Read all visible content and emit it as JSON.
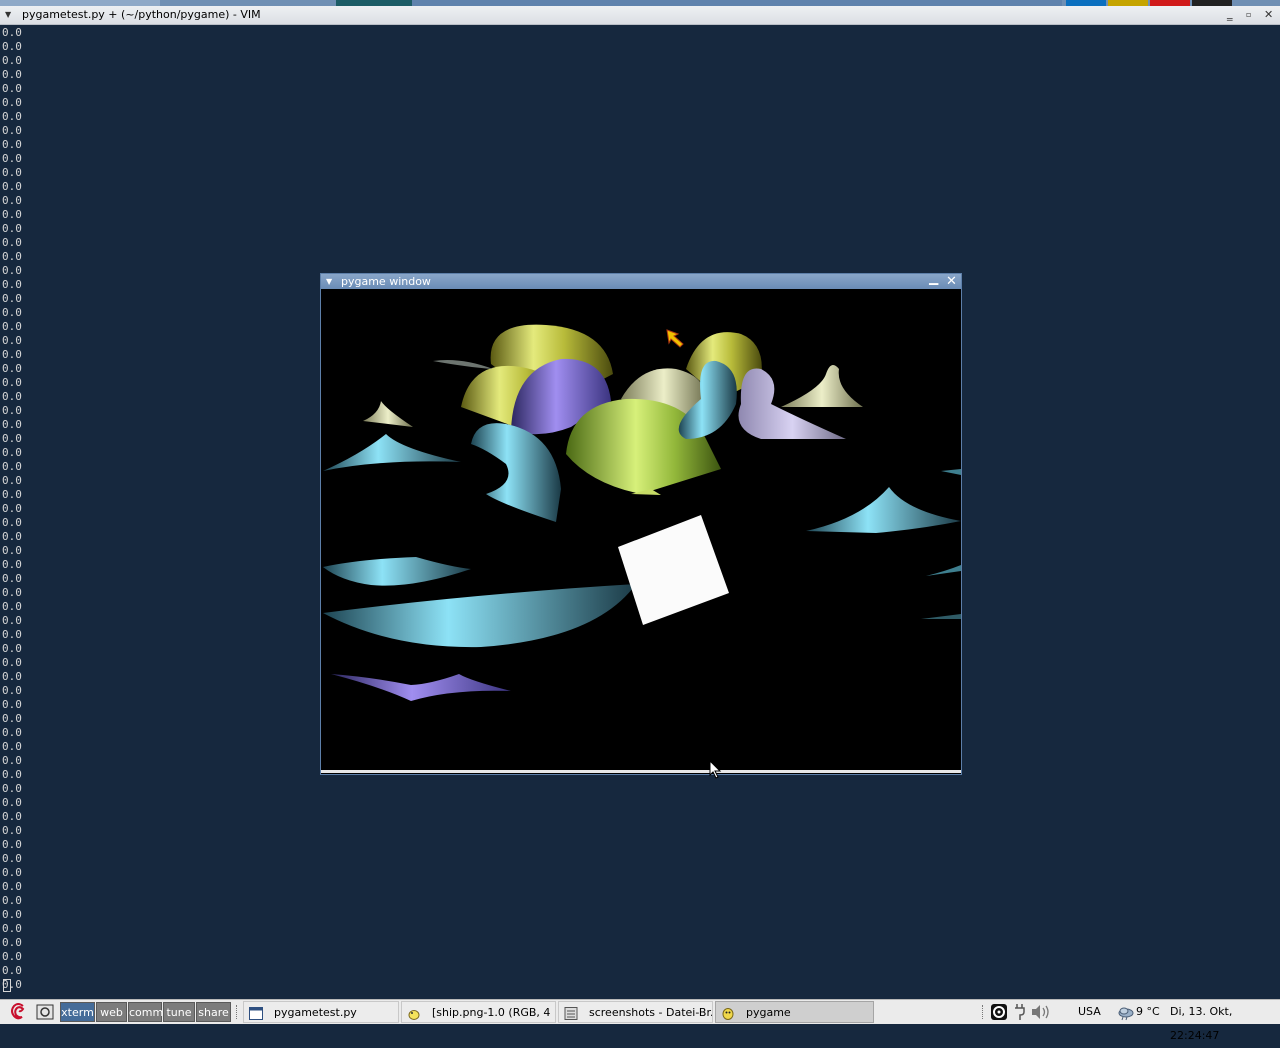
{
  "vim_window": {
    "title": "pygametest.py + (~/python/pygame) - VIM",
    "output_lines": [
      "0.0",
      "0.0",
      "0.0",
      "0.0",
      "0.0",
      "0.0",
      "0.0",
      "0.0",
      "0.0",
      "0.0",
      "0.0",
      "0.0",
      "0.0",
      "0.0",
      "0.0",
      "0.0",
      "0.0",
      "0.0",
      "0.0",
      "0.0",
      "0.0",
      "0.0",
      "0.0",
      "0.0",
      "0.0",
      "0.0",
      "0.0",
      "0.0",
      "0.0",
      "0.0",
      "0.0",
      "0.0",
      "0.0",
      "0.0",
      "0.0",
      "0.0",
      "0.0",
      "0.0",
      "0.0",
      "0.0",
      "0.0",
      "0.0",
      "0.0",
      "0.0",
      "0.0",
      "0.0",
      "0.0",
      "0.0",
      "0.0",
      "0.0",
      "0.0",
      "0.0",
      "0.0",
      "0.0",
      "0.0",
      "0.0",
      "0.0",
      "0.0",
      "0.0",
      "0.0",
      "0.0",
      "0.0",
      "0.0",
      "0.0",
      "0.0",
      "0.0",
      "0.0",
      "0.0",
      "0.0"
    ]
  },
  "pygame_window": {
    "title": "pygame window"
  },
  "taskbar": {
    "workspaces": [
      {
        "label": "xterm",
        "active": true
      },
      {
        "label": "web",
        "active": false
      },
      {
        "label": "comm",
        "active": false
      },
      {
        "label": "tune",
        "active": false
      },
      {
        "label": "share",
        "active": false
      }
    ],
    "tasks": [
      {
        "label": "pygametest.py",
        "icon": "window-icon",
        "active": false
      },
      {
        "label": "[ship.png-1.0 (RGB, 4 ...",
        "icon": "gimp-icon",
        "active": false
      },
      {
        "label": "screenshots - Datei-Br...",
        "icon": "file-manager-icon",
        "active": false
      },
      {
        "label": "pygame",
        "icon": "pygame-icon",
        "active": true
      }
    ],
    "keyboard_layout": "USA",
    "weather": "9 °C",
    "clock": "Di, 13. Okt, 22:24:47"
  },
  "colors": {
    "desktop_bg": "#16283e",
    "titlebar_active": "#6a8cb6",
    "workspace_active": "#456c99"
  }
}
